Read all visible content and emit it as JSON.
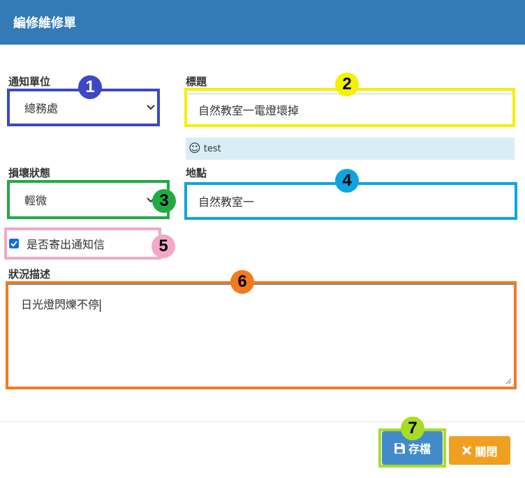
{
  "dialog": {
    "title": "編修維修單"
  },
  "fields": {
    "unit": {
      "label": "通知單位",
      "value": "總務處"
    },
    "title": {
      "label": "標題",
      "value": "自然教室一電燈壞掉"
    },
    "validation": {
      "icon": "smile-icon",
      "text": "test"
    },
    "status": {
      "label": "損壞狀態",
      "value": "輕微"
    },
    "location": {
      "label": "地點",
      "value": "自然教室一"
    },
    "notify": {
      "label": "是否寄出通知信",
      "checked": true
    },
    "description": {
      "label": "狀況描述",
      "value": "日光燈閃爍不停"
    }
  },
  "buttons": {
    "save": {
      "label": "存檔",
      "icon": "save-icon"
    },
    "close": {
      "label": "關閉",
      "icon": "close-icon"
    }
  },
  "annotations": {
    "n1": "1",
    "n2": "2",
    "n3": "3",
    "n4": "4",
    "n5": "5",
    "n6": "6",
    "n7": "7"
  },
  "colors": {
    "header": "#337ab7",
    "save_button": "#428bca",
    "close_button": "#f0a020",
    "box_1": "#3c48c6",
    "box_2": "#f5f000",
    "box_3": "#22aa44",
    "box_4": "#0ea4e0",
    "box_5": "#f4a8c8",
    "box_6": "#f47a20",
    "box_7": "#a8dc28"
  }
}
